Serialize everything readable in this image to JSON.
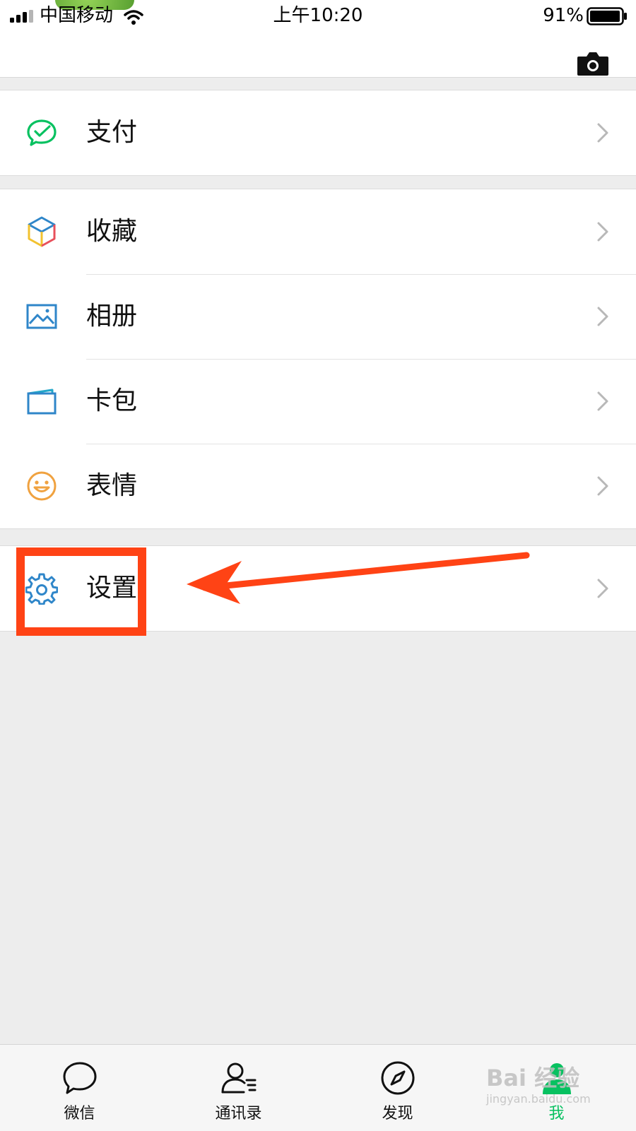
{
  "status_bar": {
    "carrier": "中国移动",
    "time": "上午10:20",
    "battery": "91%"
  },
  "menu": {
    "pay": "支付",
    "favorites": "收藏",
    "album": "相册",
    "cards": "卡包",
    "stickers": "表情",
    "settings": "设置"
  },
  "tabs": {
    "chats": "微信",
    "contacts": "通讯录",
    "discover": "发现",
    "me": "我",
    "active": "me"
  },
  "watermark": {
    "text": "Bai 经验",
    "sub": "jingyan.baidu.com"
  },
  "colors": {
    "accent_green": "#07c160",
    "annotation_red": "#ff4315",
    "icon_blue": "#2f86c9",
    "icon_orange": "#f0a240"
  }
}
